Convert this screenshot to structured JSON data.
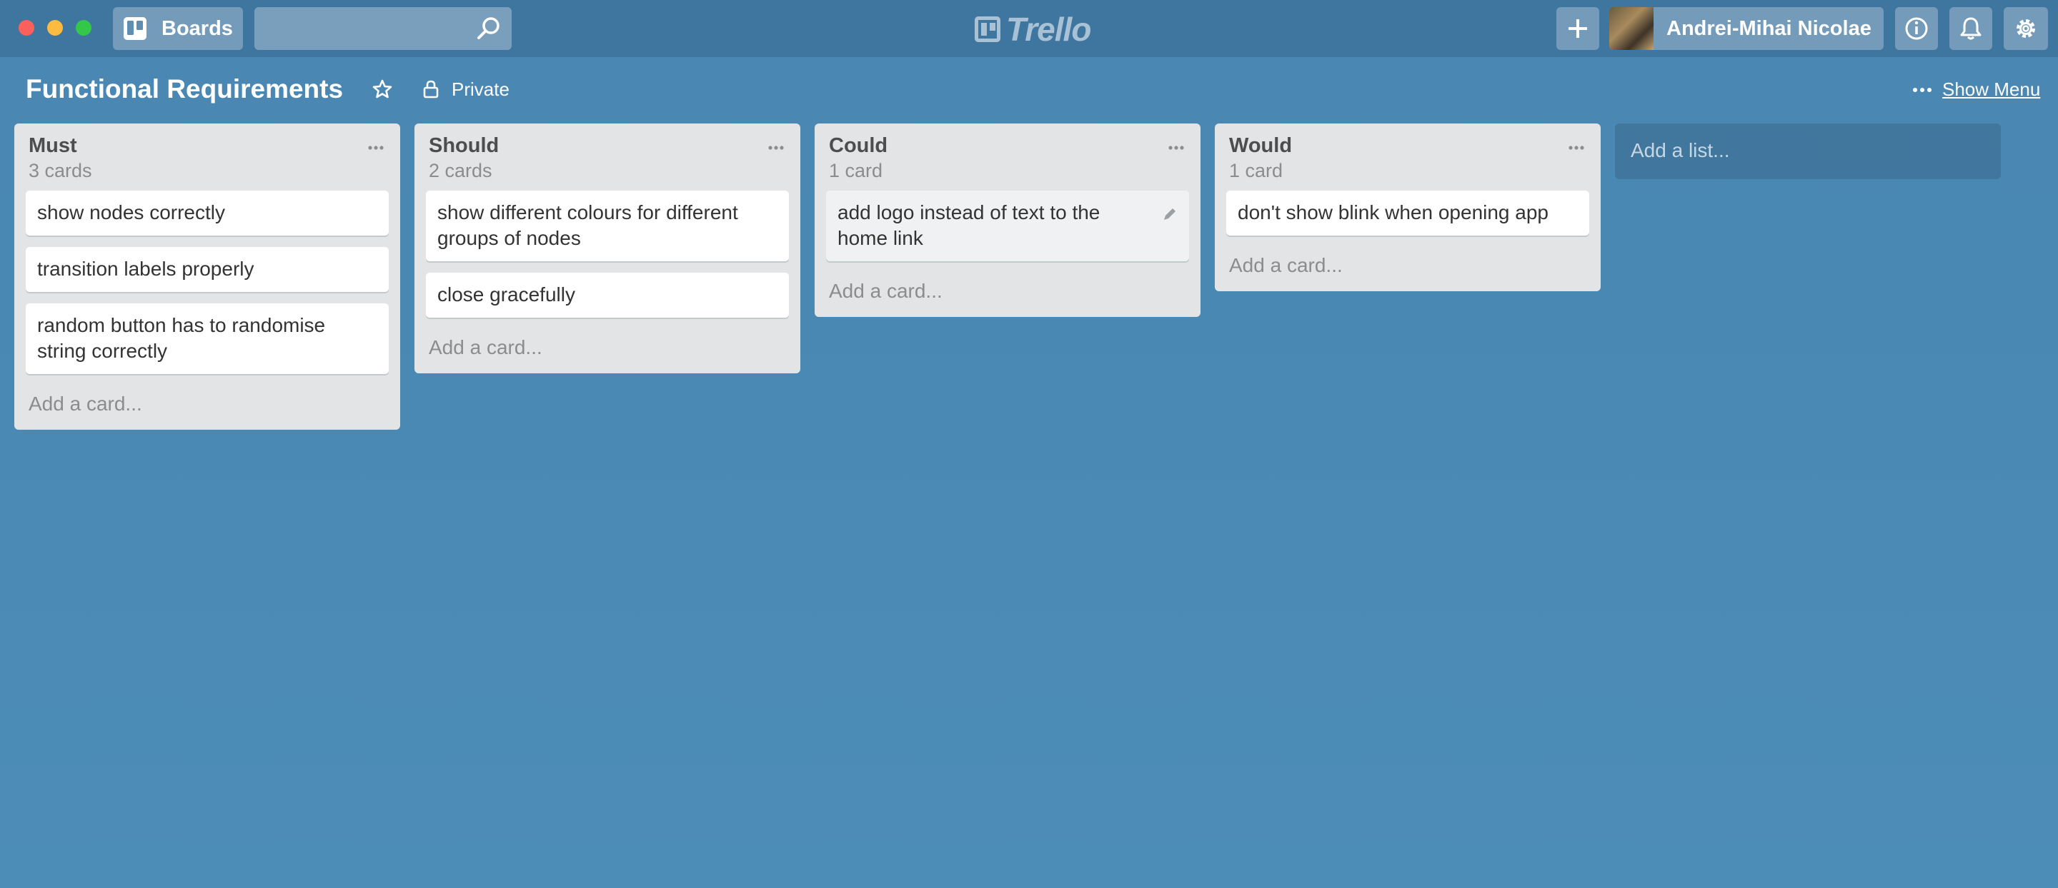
{
  "header": {
    "boards_label": "Boards",
    "search_value": "",
    "logo_text": "Trello",
    "user_name": "Andrei-Mihai Nicolae"
  },
  "board": {
    "title": "Functional Requirements",
    "privacy": "Private",
    "show_menu": "Show Menu"
  },
  "lists": [
    {
      "name": "Must",
      "count": "3 cards",
      "cards": [
        "show nodes correctly",
        "transition labels properly",
        "random button has to randomise string correctly"
      ],
      "add_card": "Add a card..."
    },
    {
      "name": "Should",
      "count": "2 cards",
      "cards": [
        "show different colours for different groups of nodes",
        "close gracefully"
      ],
      "add_card": "Add a card..."
    },
    {
      "name": "Could",
      "count": "1 card",
      "cards": [
        "add logo instead of text to the home link"
      ],
      "add_card": "Add a card..."
    },
    {
      "name": "Would",
      "count": "1 card",
      "cards": [
        "don't show blink when opening app"
      ],
      "add_card": "Add a card..."
    }
  ],
  "add_list": "Add a list...",
  "colors": {
    "board_background": "#4a89b4",
    "header_background": "#3f76a0",
    "list_background": "#e2e4e6",
    "traffic_red": "#fc605b",
    "traffic_yellow": "#fdbc40",
    "traffic_green": "#34c84a"
  }
}
